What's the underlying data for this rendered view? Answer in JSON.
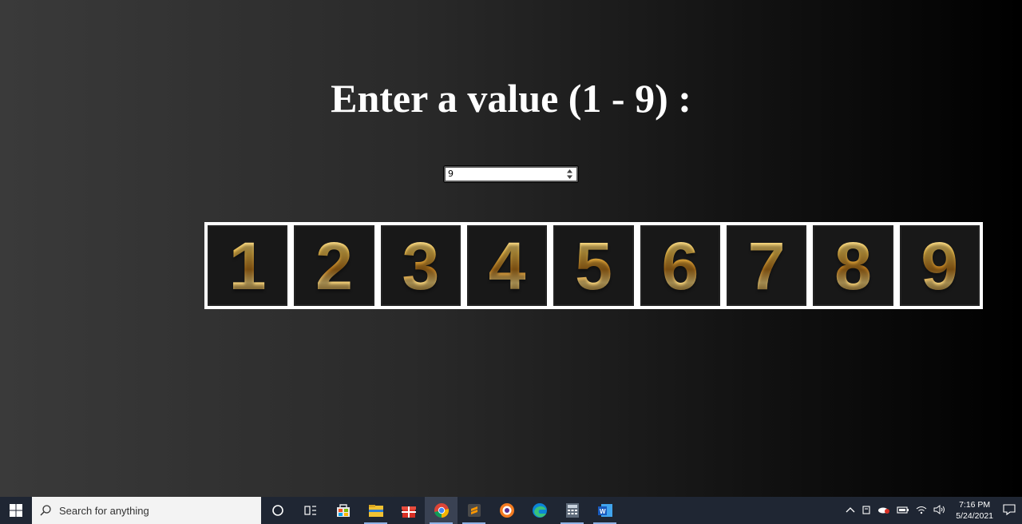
{
  "heading": "Enter a value (1 - 9) :",
  "input": {
    "value": "9"
  },
  "tiles": [
    "1",
    "2",
    "3",
    "4",
    "5",
    "6",
    "7",
    "8",
    "9"
  ],
  "taskbar": {
    "search_placeholder": "Search for anything",
    "apps": [
      "cortana-icon",
      "task-view-icon",
      "store-icon",
      "file-explorer-icon",
      "gift-app-icon",
      "chrome-icon",
      "sublime-text-icon",
      "brave-icon",
      "edge-icon",
      "calculator-icon",
      "word-icon"
    ],
    "clock_time": "7:16 PM",
    "clock_date": "5/24/2021"
  }
}
